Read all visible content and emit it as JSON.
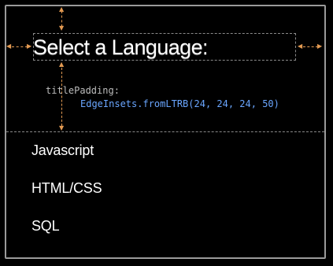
{
  "dialog": {
    "title": "Select a Language:",
    "title_padding_label": "titlePadding:",
    "title_padding_value": "EdgeInsets.fromLTRB(24, 24, 24, 50)",
    "options": [
      {
        "label": "Javascript"
      },
      {
        "label": "HTML/CSS"
      },
      {
        "label": "SQL"
      }
    ]
  },
  "colors": {
    "background": "#000000",
    "dialog_border": "#9a9a9a",
    "guide_dashes": "#8a8a8a",
    "padding_arrows": "#e39a52",
    "code_value": "#6aa6ff"
  },
  "icons": [
    "top-padding-arrow-icon",
    "left-padding-arrow-icon",
    "right-padding-arrow-icon",
    "bottom-padding-arrow-icon"
  ]
}
